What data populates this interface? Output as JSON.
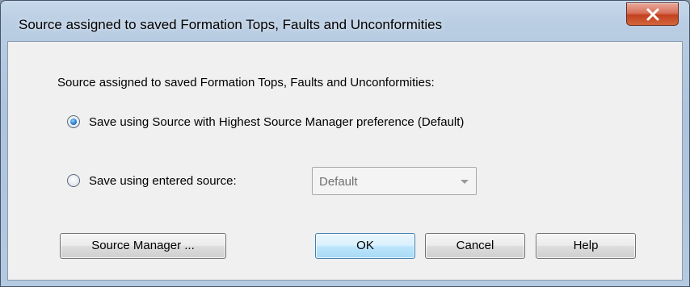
{
  "window": {
    "title": "Source assigned to saved Formation Tops, Faults and Unconformities",
    "close_icon": "close-x-icon",
    "close_color": "#c4401f"
  },
  "dialog": {
    "group_label": "Source assigned to saved Formation Tops, Faults and Unconformities:",
    "options": [
      {
        "label": "Save using Source with Highest Source Manager preference (Default)",
        "checked": true
      },
      {
        "label": "Save using entered source:",
        "checked": false
      }
    ],
    "source_dropdown": {
      "selected": "Default",
      "enabled": false
    }
  },
  "buttons": {
    "source_manager": "Source Manager ...",
    "ok": "OK",
    "cancel": "Cancel",
    "help": "Help"
  }
}
